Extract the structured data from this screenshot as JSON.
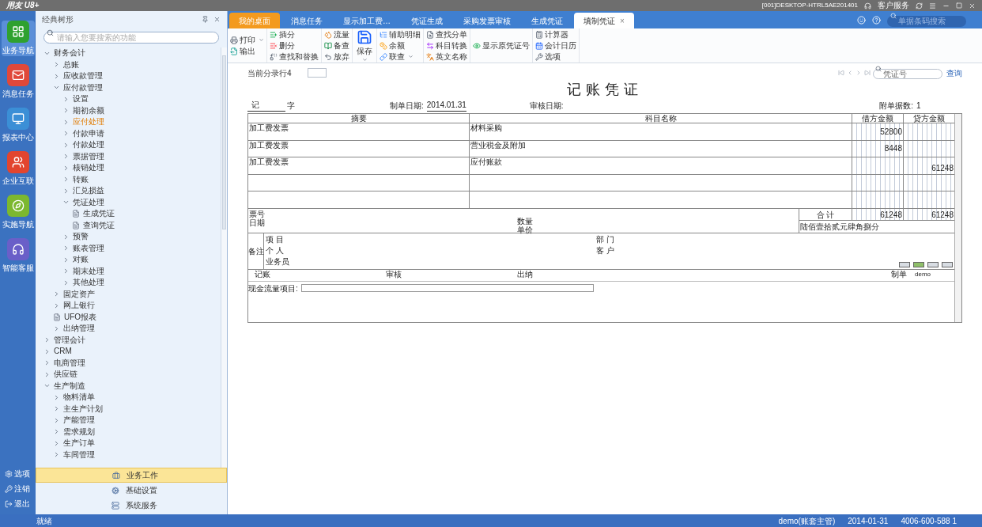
{
  "app_title": "用友 U8+",
  "title_bar": {
    "workstation": "[001]DESKTOP-HTRL5AE201401",
    "service": "客户服务"
  },
  "rail": {
    "items": [
      {
        "label": "业务导航",
        "color": "#2fa12f",
        "selected": true
      },
      {
        "label": "消息任务",
        "color": "#e0483a",
        "selected": false
      },
      {
        "label": "报表中心",
        "color": "#3b8fd6",
        "selected": false
      },
      {
        "label": "企业互联",
        "color": "#e2452f",
        "selected": false
      },
      {
        "label": "实施导航",
        "color": "#7cb82f",
        "selected": false
      },
      {
        "label": "智能客服",
        "color": "#6a5fc8",
        "selected": false
      }
    ],
    "bottom": [
      "选项",
      "注销",
      "退出"
    ]
  },
  "tree_panel": {
    "title": "经典树形",
    "search_placeholder": "请输入您要搜索的功能",
    "tree": [
      {
        "label": "财务会计",
        "kind": "folder",
        "expanded": true,
        "selected": false,
        "children": [
          {
            "label": "总账",
            "kind": "folder",
            "expanded": false,
            "selected": false
          },
          {
            "label": "应收款管理",
            "kind": "folder",
            "expanded": false,
            "selected": false
          },
          {
            "label": "应付款管理",
            "kind": "folder",
            "expanded": true,
            "selected": false,
            "children": [
              {
                "label": "设置",
                "kind": "folder",
                "expanded": false,
                "selected": false
              },
              {
                "label": "期初余额",
                "kind": "folder",
                "expanded": false,
                "selected": false
              },
              {
                "label": "应付处理",
                "kind": "folder",
                "expanded": false,
                "selected": true
              },
              {
                "label": "付款申请",
                "kind": "folder",
                "expanded": false,
                "selected": false
              },
              {
                "label": "付款处理",
                "kind": "folder",
                "expanded": false,
                "selected": false
              },
              {
                "label": "票据管理",
                "kind": "folder",
                "expanded": false,
                "selected": false
              },
              {
                "label": "核销处理",
                "kind": "folder",
                "expanded": false,
                "selected": false
              },
              {
                "label": "转账",
                "kind": "folder",
                "expanded": false,
                "selected": false
              },
              {
                "label": "汇兑损益",
                "kind": "folder",
                "expanded": false,
                "selected": false
              },
              {
                "label": "凭证处理",
                "kind": "folder",
                "expanded": true,
                "selected": false,
                "children": [
                  {
                    "label": "生成凭证",
                    "kind": "doc",
                    "selected": false
                  },
                  {
                    "label": "查询凭证",
                    "kind": "doc",
                    "selected": false
                  }
                ]
              },
              {
                "label": "预警",
                "kind": "folder",
                "expanded": false,
                "selected": false
              },
              {
                "label": "账表管理",
                "kind": "folder",
                "expanded": false,
                "selected": false
              },
              {
                "label": "对账",
                "kind": "folder",
                "expanded": false,
                "selected": false
              },
              {
                "label": "期末处理",
                "kind": "folder",
                "expanded": false,
                "selected": false
              },
              {
                "label": "其他处理",
                "kind": "folder",
                "expanded": false,
                "selected": false
              }
            ]
          },
          {
            "label": "固定资产",
            "kind": "folder",
            "expanded": false,
            "selected": false
          },
          {
            "label": "网上银行",
            "kind": "folder",
            "expanded": false,
            "selected": false
          },
          {
            "label": "UFO报表",
            "kind": "doc",
            "selected": false
          },
          {
            "label": "出纳管理",
            "kind": "folder",
            "expanded": false,
            "selected": false
          }
        ]
      },
      {
        "label": "管理会计",
        "kind": "folder",
        "expanded": false,
        "selected": false
      },
      {
        "label": "CRM",
        "kind": "folder",
        "expanded": false,
        "selected": false
      },
      {
        "label": "电商管理",
        "kind": "folder",
        "expanded": false,
        "selected": false
      },
      {
        "label": "供应链",
        "kind": "folder",
        "expanded": false,
        "selected": false
      },
      {
        "label": "生产制造",
        "kind": "folder",
        "expanded": true,
        "selected": false,
        "children": [
          {
            "label": "物料清单",
            "kind": "folder",
            "expanded": false,
            "selected": false
          },
          {
            "label": "主生产计划",
            "kind": "folder",
            "expanded": false,
            "selected": false
          },
          {
            "label": "产能管理",
            "kind": "folder",
            "expanded": false,
            "selected": false
          },
          {
            "label": "需求规划",
            "kind": "folder",
            "expanded": false,
            "selected": false
          },
          {
            "label": "生产订单",
            "kind": "folder",
            "expanded": false,
            "selected": false
          },
          {
            "label": "车间管理",
            "kind": "folder",
            "expanded": false,
            "selected": false
          }
        ]
      }
    ]
  },
  "panel_tabs": [
    {
      "label": "业务工作",
      "selected": true
    },
    {
      "label": "基础设置",
      "selected": false
    },
    {
      "label": "系统服务",
      "selected": false
    }
  ],
  "tabs": [
    {
      "label": "我的桌面",
      "kind": "home",
      "selected": false
    },
    {
      "label": "消息任务",
      "kind": "page",
      "selected": false
    },
    {
      "label": "显示加工费…",
      "kind": "page",
      "selected": false
    },
    {
      "label": "凭证生成",
      "kind": "page",
      "selected": false
    },
    {
      "label": "采购发票审核",
      "kind": "page",
      "selected": false
    },
    {
      "label": "生成凭证",
      "kind": "page",
      "selected": false
    },
    {
      "label": "填制凭证",
      "kind": "page",
      "selected": true,
      "close": "×"
    }
  ],
  "tab_search_placeholder": "单据条码搜索",
  "toolbar": [
    [
      {
        "label": "打印",
        "kind": "dropdown"
      },
      {
        "label": "输出",
        "kind": "small"
      }
    ],
    [
      {
        "label": "插分",
        "kind": "small"
      },
      {
        "label": "删分",
        "kind": "small"
      },
      {
        "label": "查找和替换",
        "kind": "small"
      }
    ],
    [
      {
        "label": "流量",
        "kind": "small"
      },
      {
        "label": "备查",
        "kind": "small"
      },
      {
        "label": "放弃",
        "kind": "small"
      }
    ],
    [
      {
        "label": "保存",
        "kind": "large"
      }
    ],
    [
      {
        "label": "辅助明细",
        "kind": "small"
      },
      {
        "label": "余额",
        "kind": "small"
      },
      {
        "label": "联查",
        "kind": "dropdown"
      }
    ],
    [
      {
        "label": "查找分单",
        "kind": "small"
      },
      {
        "label": "科目转换",
        "kind": "small"
      },
      {
        "label": "英文名称",
        "kind": "small"
      }
    ],
    [
      {
        "label": "显示原凭证号",
        "kind": "small"
      }
    ],
    [
      {
        "label": "计算器",
        "kind": "small"
      },
      {
        "label": "会计日历",
        "kind": "small"
      },
      {
        "label": "选项",
        "kind": "small"
      }
    ]
  ],
  "form": {
    "current_row": "当前分录行4",
    "voucher_search_placeholder": "凭证号",
    "query": "查询"
  },
  "voucher": {
    "title": "记账凭证",
    "type_label": "记",
    "type_suffix": "字",
    "date_label": "制单日期:",
    "date": "2014.01.31",
    "audit_date_label": "审核日期:",
    "attachments_label": "附单据数:",
    "attachments": "1",
    "columns": [
      "摘要",
      "科目名称",
      "借方金额",
      "贷方金额"
    ],
    "rows": [
      {
        "summary": "加工费发票",
        "account": "材料采购",
        "debit": "52800",
        "credit": ""
      },
      {
        "summary": "加工费发票",
        "account": "营业税金及附加",
        "debit": "8448",
        "credit": ""
      },
      {
        "summary": "加工费发票",
        "account": "应付账款",
        "debit": "",
        "credit": "61248"
      },
      {
        "summary": "",
        "account": "",
        "debit": "",
        "credit": ""
      },
      {
        "summary": "",
        "account": "",
        "debit": "",
        "credit": ""
      }
    ],
    "ticket_label": "票号",
    "date_label2": "日期",
    "qty_label": "数量",
    "price_label": "单价",
    "total_label": "合 计",
    "total_debit": "61248",
    "total_credit": "61248",
    "total_words": "陆佰壹拾贰元肆角捌分",
    "remark_label": "备注",
    "project_label": "项 目",
    "dept_label": "部 门",
    "person_label": "个 人",
    "customer_label": "客 户",
    "salesman_label": "业务员",
    "sign": {
      "bookkeeper": "记账",
      "auditor": "审核",
      "cashier": "出纳",
      "maker_label": "制单",
      "maker": "demo"
    },
    "cash_flow_label": "现金流量项目:"
  },
  "status_bar": {
    "state": "就绪",
    "user": "demo(账套主管)",
    "date": "2014-01-31",
    "phone": "4006-600-588 1"
  }
}
